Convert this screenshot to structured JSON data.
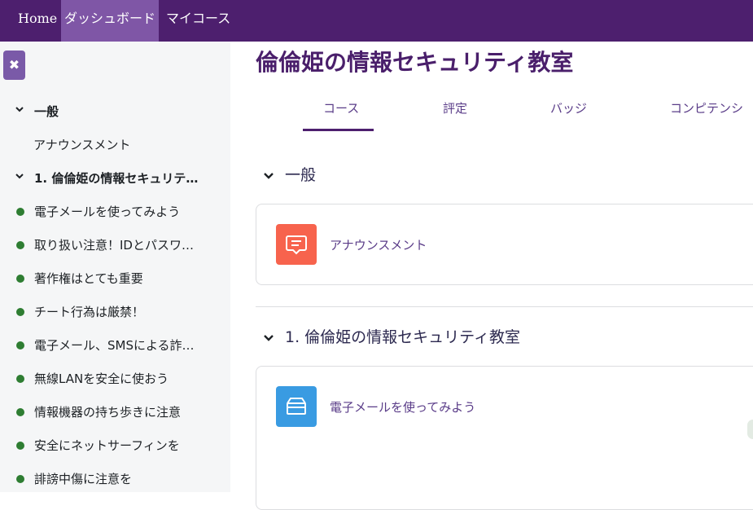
{
  "nav": {
    "home": "Home",
    "dashboard": "ダッシュボード",
    "my_courses": "マイコース"
  },
  "sidebar": {
    "close_icon": "close-icon",
    "items": [
      {
        "label": "一般",
        "type": "section"
      },
      {
        "label": "アナウンスメント",
        "type": "activity-plain"
      },
      {
        "label": "1. 倫倫姫の情報セキュリテ…",
        "type": "section"
      },
      {
        "label": "電子メールを使ってみよう",
        "type": "activity"
      },
      {
        "label": "取り扱い注意！IDとパスワ…",
        "type": "activity"
      },
      {
        "label": "著作権はとても重要",
        "type": "activity"
      },
      {
        "label": "チート行為は厳禁！",
        "type": "activity"
      },
      {
        "label": "電子メール、SMSによる詐…",
        "type": "activity"
      },
      {
        "label": "無線LANを安全に使おう",
        "type": "activity"
      },
      {
        "label": "情報機器の持ち歩きに注意",
        "type": "activity"
      },
      {
        "label": "安全にネットサーフィンを",
        "type": "activity"
      },
      {
        "label": "誹謗中傷に注意を",
        "type": "activity"
      }
    ],
    "complete_color": "#2e7d32"
  },
  "course": {
    "title": "倫倫姫の情報セキュリティ教室",
    "tabs": [
      {
        "label": "コース",
        "active": true
      },
      {
        "label": "評定",
        "active": false
      },
      {
        "label": "バッジ",
        "active": false
      },
      {
        "label": "コンピテンシ",
        "active": false
      }
    ]
  },
  "sections": [
    {
      "title": "一般",
      "activities": [
        {
          "label": "アナウンスメント",
          "icon": "forum-icon",
          "color": "#f7634d"
        }
      ]
    },
    {
      "title": "1. 倫倫姫の情報セキュリティ教室",
      "activities": [
        {
          "label": "電子メールを使ってみよう",
          "icon": "box-icon",
          "color": "#399be2"
        }
      ]
    }
  ],
  "colors": {
    "brand": "#4d1f6e",
    "nav_active": "#7f56a6",
    "link": "#5a3c88"
  }
}
